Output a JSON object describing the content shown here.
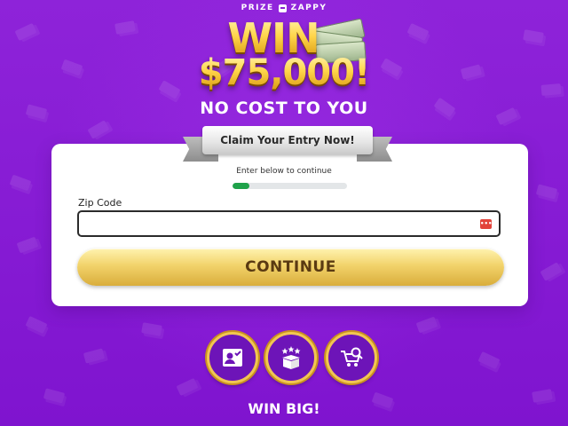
{
  "brand": {
    "name_left": "PRIZE",
    "name_right": "ZAPPY"
  },
  "headline": {
    "win": "WIN",
    "amount": "$75,000!",
    "subtitle": "NO COST TO YOU"
  },
  "ribbon": {
    "text": "Claim Your Entry Now!"
  },
  "form": {
    "instruction": "Enter below to continue",
    "progress_percent": 15,
    "progress_color": "#1fa24a",
    "zip_label": "Zip Code",
    "zip_value": "",
    "zip_placeholder": "",
    "continue_label": "CONTINUE"
  },
  "features": [
    {
      "icon": "profile-check-icon"
    },
    {
      "icon": "gift-box-stars-icon"
    },
    {
      "icon": "cart-search-icon"
    }
  ],
  "footer": {
    "text": "WIN BIG!"
  },
  "colors": {
    "background": "#8a1fd6",
    "gold": "#f1c552",
    "button_text": "#5a3a12"
  }
}
